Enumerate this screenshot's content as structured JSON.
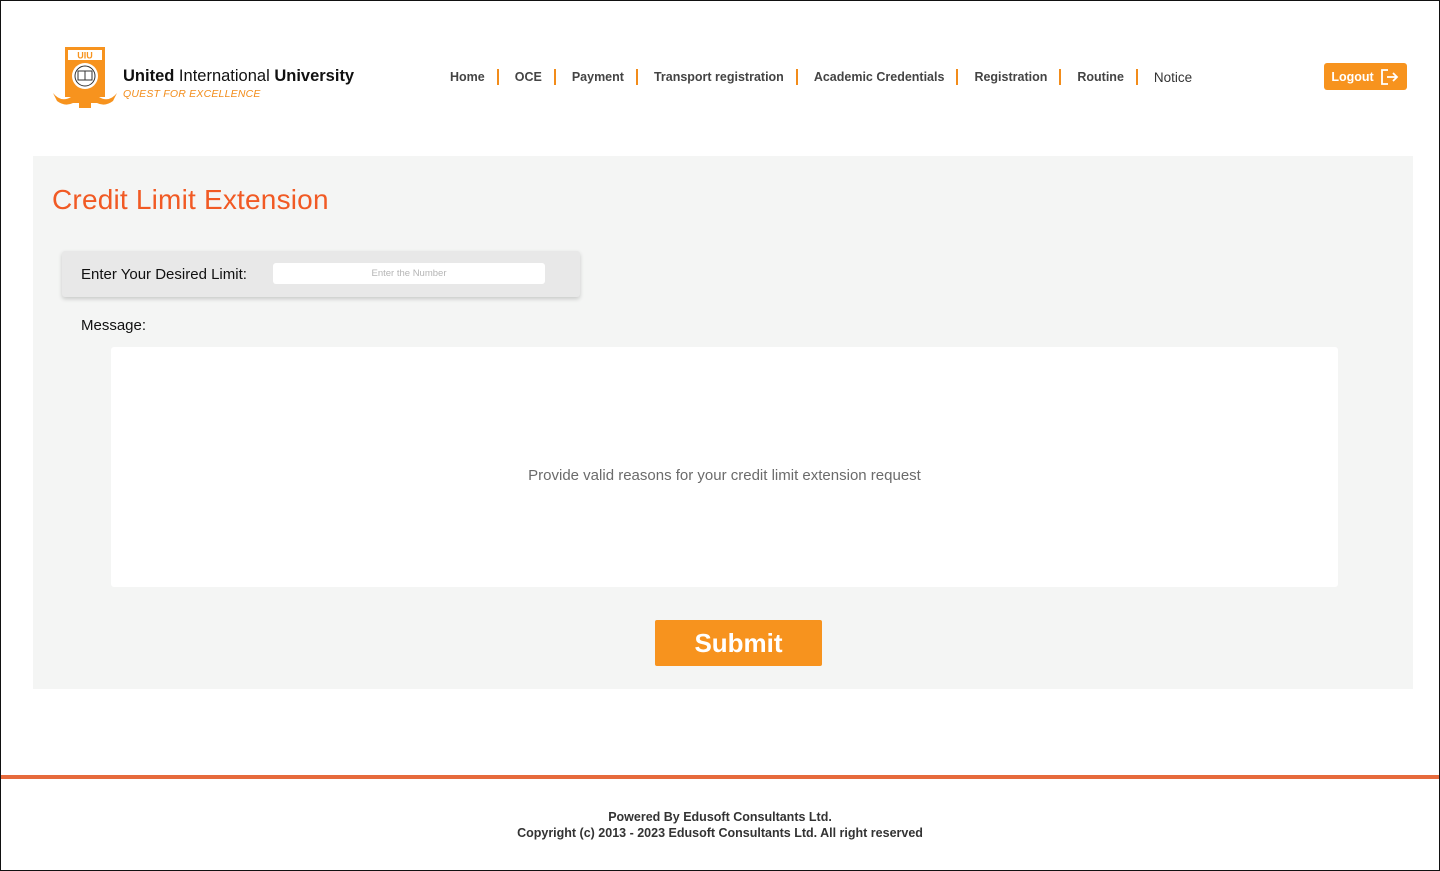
{
  "brand": {
    "name_bold_1": "United",
    "name_regular": " International ",
    "name_bold_2": "University",
    "tagline": "QUEST FOR EXCELLENCE",
    "logo_letters": "UIU",
    "accent_color": "#f7931e",
    "title_color": "#f15a24"
  },
  "nav": {
    "items": [
      {
        "label": "Home"
      },
      {
        "label": "OCE"
      },
      {
        "label": "Payment"
      },
      {
        "label": "Transport registration"
      },
      {
        "label": "Academic Credentials"
      },
      {
        "label": "Registration"
      },
      {
        "label": "Routine"
      },
      {
        "label": "Notice"
      }
    ],
    "logout_label": "Logout",
    "logout_icon": "logout-arrow-icon"
  },
  "main": {
    "title": "Credit Limit Extension",
    "limit_label": "Enter Your Desired Limit:",
    "limit_placeholder": "Enter the Number",
    "message_label": "Message:",
    "message_placeholder": "Provide valid reasons for your credit limit extension request",
    "submit_label": "Submit"
  },
  "footer": {
    "powered_by": "Powered By Edusoft Consultants Ltd.",
    "copyright": "Copyright (c) 2013 - 2023 Edusoft Consultants Ltd. All right reserved"
  }
}
